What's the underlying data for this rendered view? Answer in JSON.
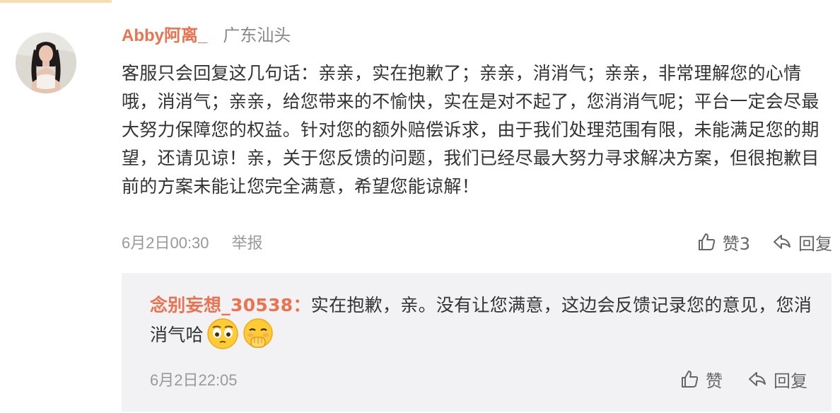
{
  "comment": {
    "username": "Abby阿离_",
    "location": "广东汕头",
    "text": "客服只会回复这几句话：亲亲，实在抱歉了；亲亲，消消气；亲亲，非常理解您的心情哦，消消气；亲亲，给您带来的不愉快，实在是对不起了，您消消气呢；平台一定会尽最大努力保障您的权益。针对您的额外赔偿诉求，由于我们处理范围有限，未能满足您的期望，还请见谅！亲，关于您反馈的问题，我们已经尽最大努力寻求解决方案，但很抱歉目前的方案未能让您完全满意，希望您能谅解！",
    "time": "6月2日00:30",
    "report_label": "举报",
    "like_label": "赞3",
    "reply_label": "回复"
  },
  "reply": {
    "username": "念别妄想_30538：",
    "text": "实在抱歉，亲。没有让您满意，这边会反馈记录您的意见，您消消气哈",
    "emojis": [
      "face-emoji",
      "cover-mouth-emoji"
    ],
    "time": "6月2日22:05",
    "like_label": "赞",
    "reply_label": "回复"
  },
  "icons": {
    "like": "thumbs-up-icon",
    "reply": "reply-arrow-icon"
  },
  "colors": {
    "username": "#eb7350",
    "meta": "#999999",
    "reply_background": "#f2f2f5",
    "accent_bar": "#f6ddb2"
  }
}
